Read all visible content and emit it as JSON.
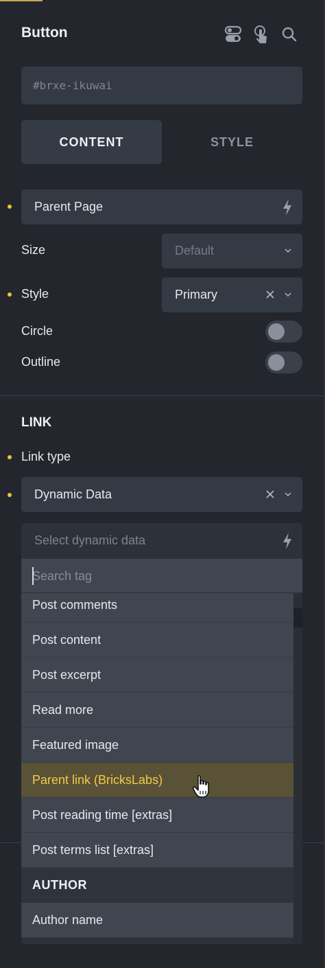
{
  "header": {
    "title": "Button",
    "icons": [
      "toggle-icon",
      "pointer-hand-icon",
      "search-icon"
    ]
  },
  "element_id": "#brxe-ikuwai",
  "tabs": [
    {
      "label": "CONTENT",
      "active": true
    },
    {
      "label": "STYLE",
      "active": false
    }
  ],
  "content": {
    "text_field_value": "Parent Page",
    "size": {
      "label": "Size",
      "placeholder": "Default"
    },
    "style": {
      "label": "Style",
      "value": "Primary"
    },
    "circle": {
      "label": "Circle",
      "on": false
    },
    "outline": {
      "label": "Outline",
      "on": false
    }
  },
  "link": {
    "section_title": "LINK",
    "link_type_label": "Link type",
    "link_type_value": "Dynamic Data",
    "dynamic_placeholder": "Select dynamic data",
    "search_placeholder": "Search tag",
    "items": [
      {
        "label": "Post comments"
      },
      {
        "label": "Post content"
      },
      {
        "label": "Post excerpt"
      },
      {
        "label": "Read more"
      },
      {
        "label": "Featured image"
      },
      {
        "label": "Parent link (BricksLabs)",
        "highlighted": true
      },
      {
        "label": "Post reading time [extras]"
      },
      {
        "label": "Post terms list [extras]"
      }
    ],
    "group_author": "AUTHOR",
    "author_items": [
      {
        "label": "Author name"
      }
    ]
  },
  "colors": {
    "background": "#23262d",
    "field": "#343a43",
    "accent_dot": "#f0c040",
    "highlight_bg": "#5a5236",
    "highlight_text": "#f2c94c"
  }
}
